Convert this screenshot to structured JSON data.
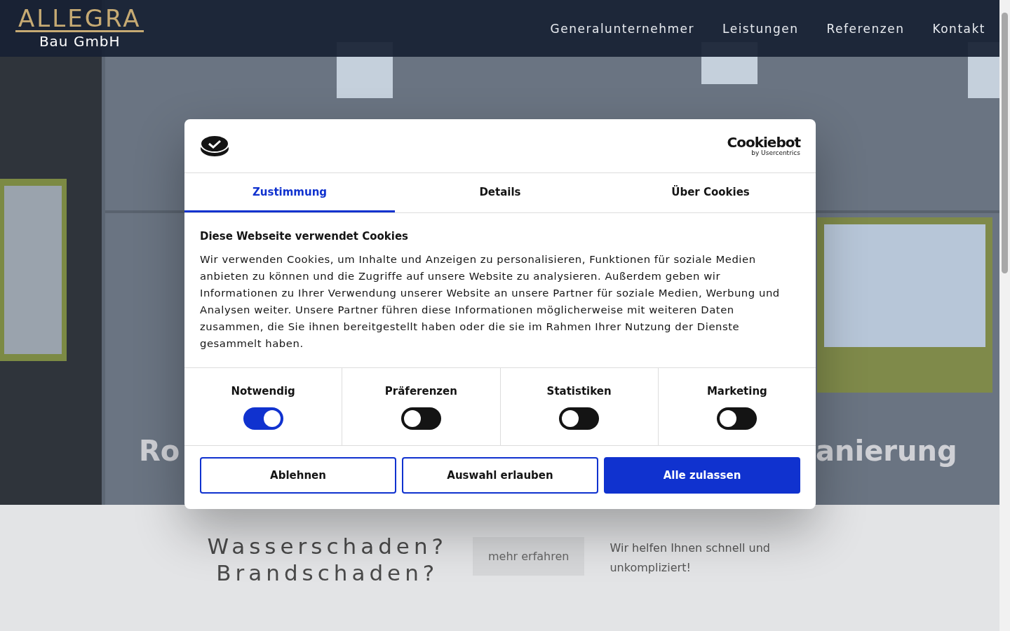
{
  "header": {
    "logo": {
      "name": "ALLEGRA",
      "subtitle": "Bau GmbH"
    },
    "nav": [
      {
        "label": "Generalunternehmer"
      },
      {
        "label": "Leistungen"
      },
      {
        "label": "Referenzen"
      },
      {
        "label": "Kontakt"
      }
    ]
  },
  "hero": {
    "heading_left": "Ro",
    "heading_right": "anierung"
  },
  "cookie_dialog": {
    "brand": "Cookiebot",
    "brand_sub": "by Usercentrics",
    "tabs": [
      {
        "label": "Zustimmung",
        "selected": true
      },
      {
        "label": "Details",
        "selected": false
      },
      {
        "label": "Über Cookies",
        "selected": false
      }
    ],
    "heading": "Diese Webseite verwendet Cookies",
    "body": "Wir verwenden Cookies, um Inhalte und Anzeigen zu personalisieren, Funktionen für soziale Medien anbieten zu können und die Zugriffe auf unsere Website zu analysieren. Außerdem geben wir Informationen zu Ihrer Verwendung unserer Website an unsere Partner für soziale Medien, Werbung und Analysen weiter. Unsere Partner führen diese Informationen möglicherweise mit weiteren Daten zusammen, die Sie ihnen bereitgestellt haben oder die sie im Rahmen Ihrer Nutzung der Dienste gesammelt haben.",
    "categories": [
      {
        "label": "Notwendig",
        "checked": true
      },
      {
        "label": "Präferenzen",
        "checked": false
      },
      {
        "label": "Statistiken",
        "checked": false
      },
      {
        "label": "Marketing",
        "checked": false
      }
    ],
    "buttons": [
      {
        "label": "Ablehnen",
        "kind": "outline"
      },
      {
        "label": "Auswahl erlauben",
        "kind": "outline"
      },
      {
        "label": "Alle zulassen",
        "kind": "primary"
      }
    ]
  },
  "teaser": {
    "heading_lines": [
      "Wasserschaden?",
      "Brandschaden?"
    ],
    "button": "mehr erfahren",
    "text": "Wir helfen Ihnen schnell und unkompliziert!"
  }
}
